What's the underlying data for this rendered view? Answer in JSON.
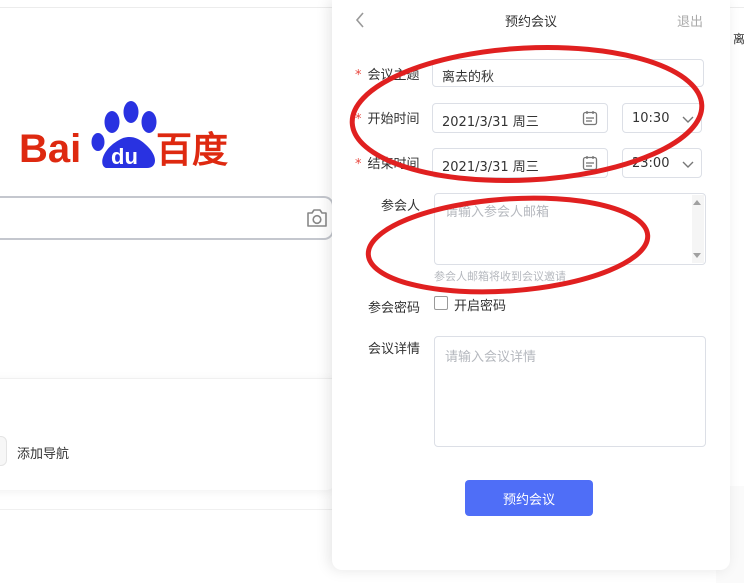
{
  "background": {
    "logo_text": "Bai du 百度",
    "add_nav_label": "添加导航",
    "right_edge_text": "离"
  },
  "dialog": {
    "title": "预约会议",
    "exit_label": "退出",
    "topic": {
      "label": "会议主题",
      "required": "*",
      "value": "离去的秋"
    },
    "start": {
      "label": "开始时间",
      "required": "*",
      "date": "2021/3/31  周三",
      "time": "10:30"
    },
    "end": {
      "label": "结束时间",
      "required": "*",
      "date": "2021/3/31  周三",
      "time": "23:00"
    },
    "participants": {
      "label": "参会人",
      "placeholder": "请输入参会人邮箱",
      "hint": "参会人邮箱将收到会议邀请"
    },
    "password": {
      "label": "参会密码",
      "checkbox_label": "开启密码",
      "checked": false
    },
    "details": {
      "label": "会议详情",
      "placeholder": "请输入会议详情"
    },
    "submit_label": "预约会议"
  },
  "colors": {
    "accent": "#4f6ef7",
    "required": "#e8453c",
    "annotation": "#e02020",
    "baidu_red": "#de2910",
    "baidu_blue": "#2932e1"
  },
  "icons": [
    "back-chevron-icon",
    "calendar-icon",
    "chevron-down-icon",
    "camera-icon",
    "baidu-paw-icon"
  ]
}
